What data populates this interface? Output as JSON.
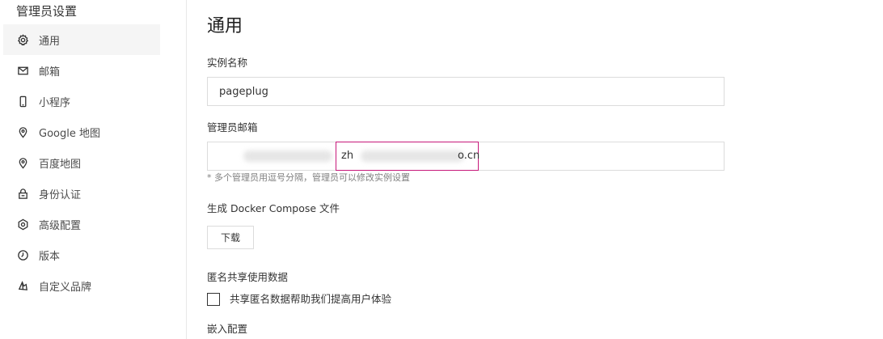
{
  "sidebar": {
    "title": "管理员设置",
    "items": [
      {
        "label": "通用",
        "icon": "gear-icon"
      },
      {
        "label": "邮箱",
        "icon": "mail-icon"
      },
      {
        "label": "小程序",
        "icon": "mobile-icon"
      },
      {
        "label": "Google 地图",
        "icon": "location-pin-icon"
      },
      {
        "label": "百度地图",
        "icon": "location-pin-icon"
      },
      {
        "label": "身份认证",
        "icon": "lock-icon"
      },
      {
        "label": "高级配置",
        "icon": "hexagon-gear-icon"
      },
      {
        "label": "版本",
        "icon": "clock-icon"
      },
      {
        "label": "自定义品牌",
        "icon": "brand-icon"
      }
    ]
  },
  "main": {
    "title": "通用",
    "instance_name": {
      "label": "实例名称",
      "value": "pageplug"
    },
    "admin_email": {
      "label": "管理员邮箱",
      "value_prefix": "zh",
      "value_suffix": "o.cn",
      "hint": "* 多个管理员用逗号分隔，管理员可以修改实例设置"
    },
    "docker": {
      "label": "生成 Docker Compose 文件",
      "button": "下载"
    },
    "anonymous": {
      "label": "匿名共享使用数据",
      "checkbox_label": "共享匿名数据帮助我们提高用户体验",
      "checked": false
    },
    "embed": {
      "label": "嵌入配置"
    }
  },
  "colors": {
    "focus_border": "#c7187a",
    "active_nav_bg": "#f5f5f5"
  }
}
